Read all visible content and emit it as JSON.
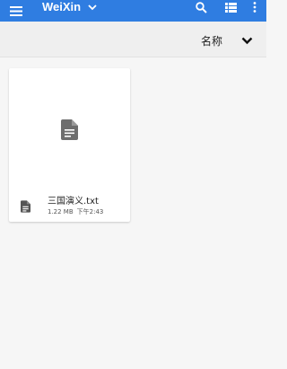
{
  "appbar": {
    "title": "WeiXin",
    "background": "#2f7de1",
    "icons": [
      "menu-icon",
      "chevron-down-icon",
      "search-icon",
      "view-list-icon",
      "more-vert-icon"
    ]
  },
  "sortbar": {
    "sort_label": "名称",
    "chevron": "chevron-down-icon"
  },
  "files": [
    {
      "name": "三国演义.txt",
      "size": "1.22 MB",
      "time": "下午2:43",
      "icon": "document-icon"
    }
  ]
}
